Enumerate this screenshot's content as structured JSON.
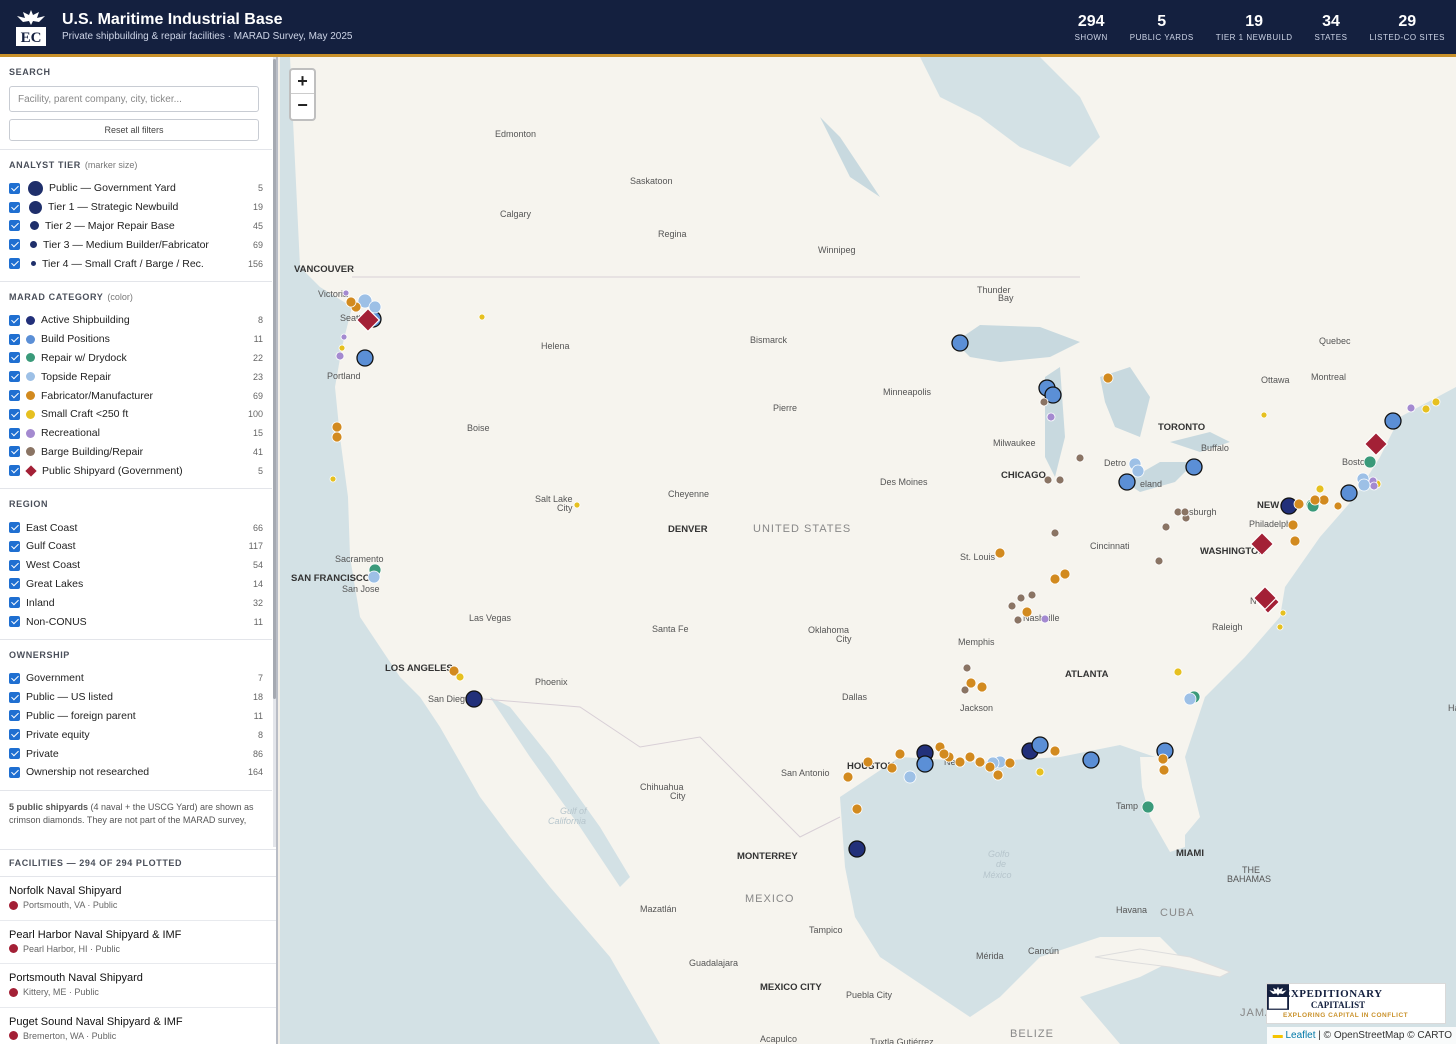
{
  "header": {
    "logo_text": "EC",
    "title": "U.S. Maritime Industrial Base",
    "subtitle": "Private shipbuilding & repair facilities · MARAD Survey, May 2025",
    "stats": [
      {
        "value": "294",
        "label": "SHOWN"
      },
      {
        "value": "5",
        "label": "PUBLIC YARDS"
      },
      {
        "value": "19",
        "label": "TIER 1 NEWBUILD"
      },
      {
        "value": "34",
        "label": "STATES"
      },
      {
        "value": "29",
        "label": "LISTED-CO SITES"
      }
    ]
  },
  "search": {
    "title": "SEARCH",
    "placeholder": "Facility, parent company, city, ticker...",
    "reset_label": "Reset all filters"
  },
  "tier": {
    "title": "ANALYST TIER",
    "note": "(marker size)",
    "items": [
      {
        "label": "Public — Government Yard",
        "count": "5"
      },
      {
        "label": "Tier 1 — Strategic Newbuild",
        "count": "19"
      },
      {
        "label": "Tier 2 — Major Repair Base",
        "count": "45"
      },
      {
        "label": "Tier 3 — Medium Builder/Fabricator",
        "count": "69"
      },
      {
        "label": "Tier 4 — Small Craft / Barge / Rec.",
        "count": "156"
      }
    ]
  },
  "category": {
    "title": "MARAD CATEGORY",
    "note": "(color)",
    "items": [
      {
        "label": "Active Shipbuilding",
        "count": "8",
        "color": "#22307a"
      },
      {
        "label": "Build Positions",
        "count": "11",
        "color": "#5b8fd6"
      },
      {
        "label": "Repair w/ Drydock",
        "count": "22",
        "color": "#3a9a7a"
      },
      {
        "label": "Topside Repair",
        "count": "23",
        "color": "#9dc0e6"
      },
      {
        "label": "Fabricator/Manufacturer",
        "count": "69",
        "color": "#d28a1f"
      },
      {
        "label": "Small Craft <250 ft",
        "count": "100",
        "color": "#e6c020"
      },
      {
        "label": "Recreational",
        "count": "15",
        "color": "#a48ad0"
      },
      {
        "label": "Barge Building/Repair",
        "count": "41",
        "color": "#8a7464"
      },
      {
        "label": "Public Shipyard (Government)",
        "count": "5",
        "color": "#a32036"
      }
    ]
  },
  "region": {
    "title": "REGION",
    "items": [
      {
        "label": "East Coast",
        "count": "66"
      },
      {
        "label": "Gulf Coast",
        "count": "117"
      },
      {
        "label": "West Coast",
        "count": "54"
      },
      {
        "label": "Great Lakes",
        "count": "14"
      },
      {
        "label": "Inland",
        "count": "32"
      },
      {
        "label": "Non-CONUS",
        "count": "11"
      }
    ]
  },
  "ownership": {
    "title": "OWNERSHIP",
    "items": [
      {
        "label": "Government",
        "count": "7"
      },
      {
        "label": "Public — US listed",
        "count": "18"
      },
      {
        "label": "Public — foreign parent",
        "count": "11"
      },
      {
        "label": "Private equity",
        "count": "8"
      },
      {
        "label": "Private",
        "count": "86"
      },
      {
        "label": "Ownership not researched",
        "count": "164"
      }
    ]
  },
  "note": {
    "bold": "5 public shipyards",
    "text": " (4 naval + the USCG Yard) are shown as crimson diamonds. They are not part of the MARAD survey, which covers private yards only, and are excluded from the"
  },
  "facilities": {
    "title": "FACILITIES — 294 OF 294 PLOTTED",
    "items": [
      {
        "name": "Norfolk Naval Shipyard",
        "meta": "Portsmouth, VA · Public"
      },
      {
        "name": "Pearl Harbor Naval Shipyard & IMF",
        "meta": "Pearl Harbor, HI · Public"
      },
      {
        "name": "Portsmouth Naval Shipyard",
        "meta": "Kittery, ME · Public"
      },
      {
        "name": "Puget Sound Naval Shipyard & IMF",
        "meta": "Bremerton, WA · Public"
      }
    ]
  },
  "map": {
    "zoom_in": "+",
    "zoom_out": "−",
    "badge_title_1": "EXPEDITIONARY",
    "badge_title_2": "CAPITALIST",
    "badge_tagline": "EXPLORING CAPITAL IN CONFLICT",
    "attribution_leaflet": "Leaflet",
    "attribution_rest": " | © OpenStreetMap © CARTO",
    "labels": {
      "edmonton": "Edmonton",
      "saskatoon": "Saskatoon",
      "calgary": "Calgary",
      "regina": "Regina",
      "winnipeg": "Winnipeg",
      "vancouver": "VANCOUVER",
      "victoria": "Victoria",
      "seattle": "Seattle",
      "portland": "Portland",
      "helena": "Helena",
      "bismarck": "Bismarck",
      "thunder1": "Thunder",
      "thunder2": "Bay",
      "quebec": "Quebec",
      "ottawa": "Ottawa",
      "montreal": "Montreal",
      "minneapolis": "Minneapolis",
      "pierre": "Pierre",
      "boise": "Boise",
      "toronto": "TORONTO",
      "milwaukee": "Milwaukee",
      "buffalo": "Buffalo",
      "boston": "Boston",
      "detroit": "Detro",
      "cleveland": "eland",
      "chicago": "CHICAGO",
      "desmoines": "Des Moines",
      "cheyenne": "Cheyenne",
      "saltlake1": "Salt Lake",
      "saltlake2": "City",
      "pittsburgh": "Pittsburgh",
      "newyork": "NEW YOR",
      "philadelphia": "Philadelph",
      "denver": "DENVER",
      "unitedstates": "UNITED STATES",
      "cincinnati": "Cincinnati",
      "washington": "WASHINGTON",
      "sacramento": "Sacramento",
      "stlouis": "St. Louis",
      "sanfrancisco": "SAN FRANCISCO",
      "sanjose": "San Jose",
      "norfolk": "Norfo",
      "lasvegas": "Las Vegas",
      "nashville": "Nashville",
      "santafe": "Santa Fe",
      "oklahoma1": "Oklahoma",
      "oklahoma2": "City",
      "raleigh": "Raleigh",
      "memphis": "Memphis",
      "losangeles": "LOS ANGELES",
      "atlanta": "ATLANTA",
      "phoenix": "Phoenix",
      "sandiego": "San Dieg",
      "dallas": "Dallas",
      "jackson": "Jackson",
      "houston": "HOUSTON",
      "neworleans": "Ne",
      "sanantonio": "San Antonio",
      "chihuahua1": "Chihuahua",
      "chihuahua2": "City",
      "tampa": "Tamp",
      "gulfca1": "Gulf of",
      "gulfca2": "California",
      "monterrey": "MONTERREY",
      "miami": "MIAMI",
      "gulfmx1": "Golfo",
      "gulfmx2": "de",
      "gulfmx3": "México",
      "bahamas1": "THE",
      "bahamas2": "BAHAMAS",
      "mexico": "MEXICO",
      "mazatlan": "Mazatlán",
      "havana": "Havana",
      "cuba": "CUBA",
      "tampico": "Tampico",
      "guadalajara": "Guadalajara",
      "merida": "Mérida",
      "cancun": "Cancún",
      "jamaica": "JAMAICA",
      "mexicocity": "MEXICO CITY",
      "puebla": "Puebla City",
      "belize": "BELIZE",
      "acapulco": "Acapulco",
      "tuxtla": "Tuxtla Gutiérrez",
      "halifax": "Ha"
    }
  }
}
